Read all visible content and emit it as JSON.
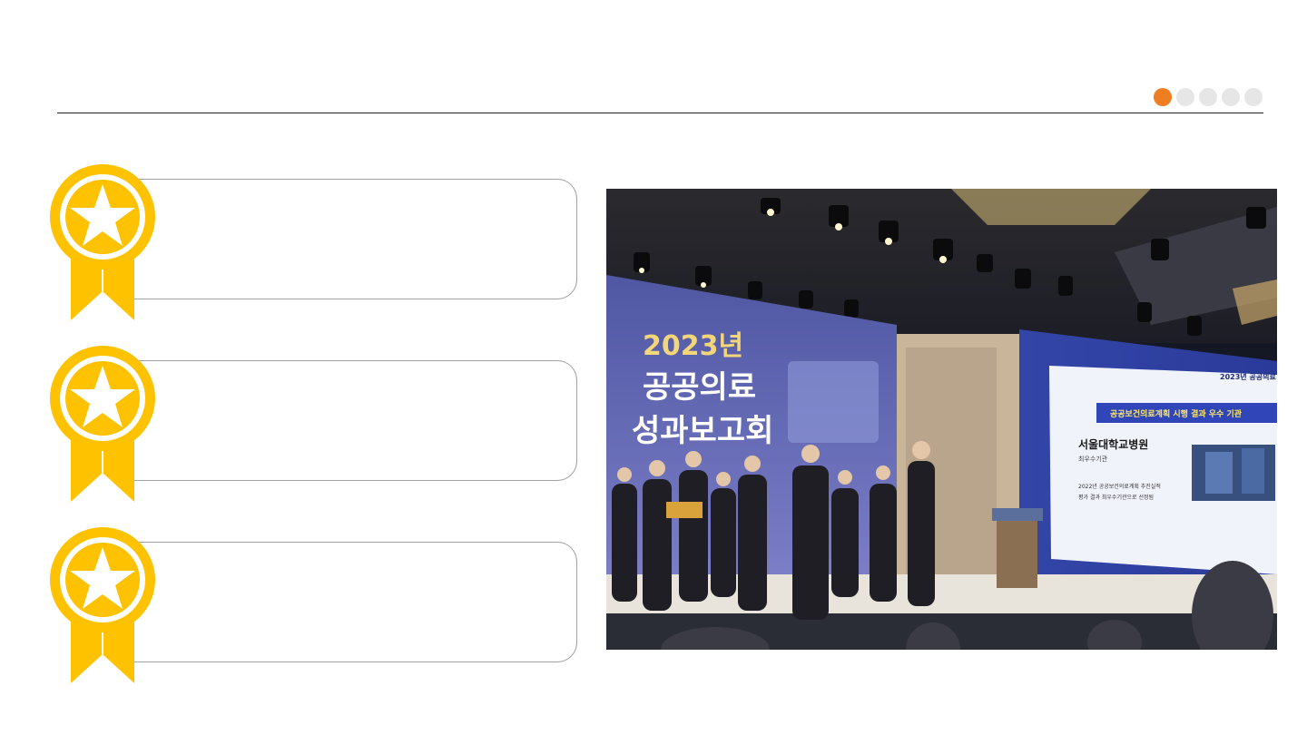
{
  "header": {
    "pagination": {
      "total": 5,
      "active_index": 0,
      "active_color": "#ef7d22",
      "inactive_color": "#e6e6e6"
    }
  },
  "awards": [
    {
      "text": ""
    },
    {
      "text": ""
    },
    {
      "text": ""
    }
  ],
  "medal": {
    "icon": "award-medal-icon",
    "color": "#fec200"
  },
  "photo": {
    "banner": {
      "year": "2023년",
      "line1": "공공의료",
      "line2": "성과보고회"
    },
    "screen": {
      "top_label": "2023년 공공의료",
      "subtitle": "공공보건의료계획 시행 결과 우수 기관",
      "hospital": "서울대학교병원",
      "tag": "최우수기관",
      "note_line1": "2022년 공공보건의료계획 추진실적",
      "note_line2": "평가 결과 최우수기관으로 선정됨"
    }
  }
}
